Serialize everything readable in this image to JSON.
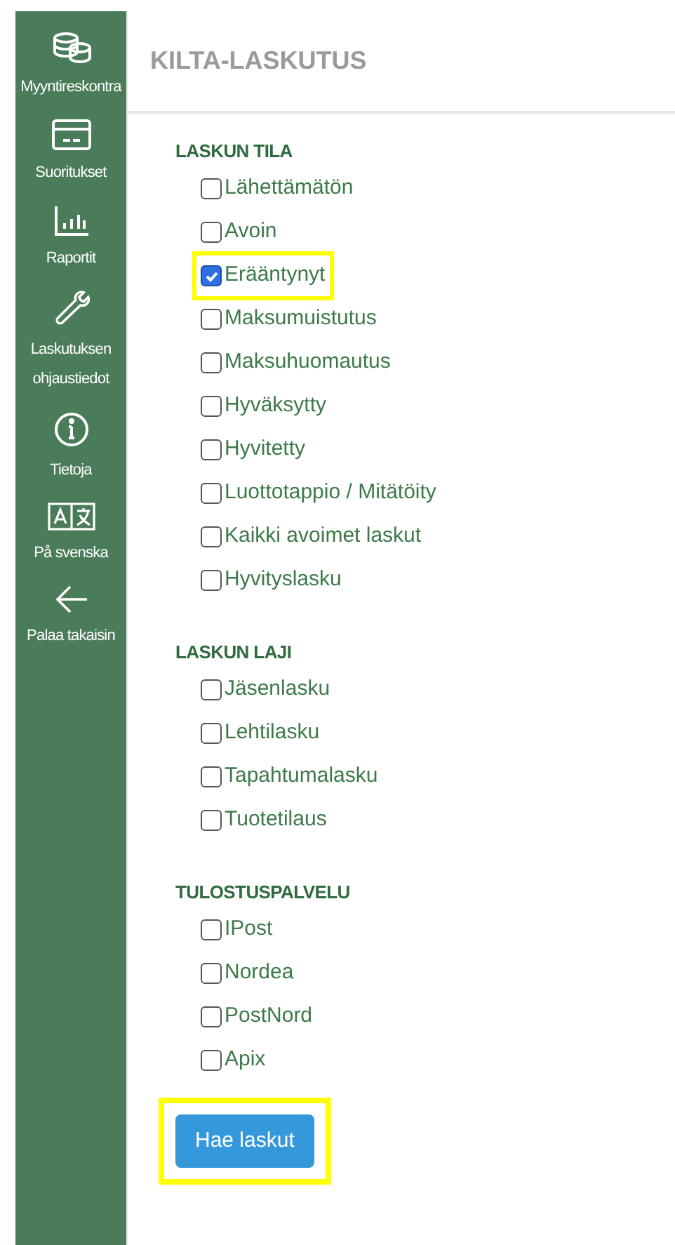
{
  "sidebar": {
    "items": [
      {
        "label": "Myyntireskontra"
      },
      {
        "label": "Suoritukset"
      },
      {
        "label": "Raportit"
      },
      {
        "label": "Laskutuksen ohjaustiedot"
      },
      {
        "label": "Tietoja"
      },
      {
        "label": "På svenska"
      },
      {
        "label": "Palaa takaisin"
      }
    ]
  },
  "title": "KILTA-LASKUTUS",
  "sections": [
    {
      "heading": "LASKUN TILA",
      "options": [
        {
          "label": "Lähettämätön",
          "checked": false,
          "highlighted": false
        },
        {
          "label": "Avoin",
          "checked": false,
          "highlighted": false
        },
        {
          "label": "Erääntynyt",
          "checked": true,
          "highlighted": true
        },
        {
          "label": "Maksumuistutus",
          "checked": false,
          "highlighted": false
        },
        {
          "label": "Maksuhuomautus",
          "checked": false,
          "highlighted": false
        },
        {
          "label": "Hyväksytty",
          "checked": false,
          "highlighted": false
        },
        {
          "label": "Hyvitetty",
          "checked": false,
          "highlighted": false
        },
        {
          "label": "Luottotappio / Mitätöity",
          "checked": false,
          "highlighted": false
        },
        {
          "label": "Kaikki avoimet laskut",
          "checked": false,
          "highlighted": false
        },
        {
          "label": "Hyvityslasku",
          "checked": false,
          "highlighted": false
        }
      ]
    },
    {
      "heading": "LASKUN LAJI",
      "options": [
        {
          "label": "Jäsenlasku",
          "checked": false,
          "highlighted": false
        },
        {
          "label": "Lehtilasku",
          "checked": false,
          "highlighted": false
        },
        {
          "label": "Tapahtumalasku",
          "checked": false,
          "highlighted": false
        },
        {
          "label": "Tuotetilaus",
          "checked": false,
          "highlighted": false
        }
      ]
    },
    {
      "heading": "TULOSTUSPALVELU",
      "options": [
        {
          "label": "IPost",
          "checked": false,
          "highlighted": false
        },
        {
          "label": "Nordea",
          "checked": false,
          "highlighted": false
        },
        {
          "label": "PostNord",
          "checked": false,
          "highlighted": false
        },
        {
          "label": "Apix",
          "checked": false,
          "highlighted": false
        }
      ]
    }
  ],
  "submit": {
    "label": "Hae laskut",
    "highlighted": true
  }
}
